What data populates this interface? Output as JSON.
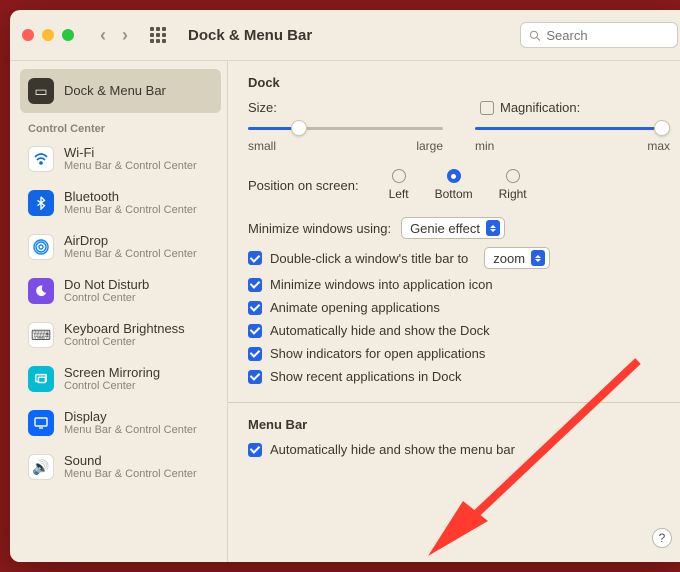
{
  "titlebar": {
    "title": "Dock & Menu Bar",
    "search_placeholder": "Search"
  },
  "sidebar": {
    "heading": "Control Center",
    "items": [
      {
        "label": "Dock & Menu Bar",
        "sub": ""
      },
      {
        "label": "Wi-Fi",
        "sub": "Menu Bar & Control Center"
      },
      {
        "label": "Bluetooth",
        "sub": "Menu Bar & Control Center"
      },
      {
        "label": "AirDrop",
        "sub": "Menu Bar & Control Center"
      },
      {
        "label": "Do Not Disturb",
        "sub": "Control Center"
      },
      {
        "label": "Keyboard Brightness",
        "sub": "Control Center"
      },
      {
        "label": "Screen Mirroring",
        "sub": "Control Center"
      },
      {
        "label": "Display",
        "sub": "Menu Bar & Control Center"
      },
      {
        "label": "Sound",
        "sub": "Menu Bar & Control Center"
      }
    ]
  },
  "dock": {
    "section_title": "Dock",
    "size_label": "Size:",
    "magnification_label": "Magnification:",
    "small": "small",
    "large": "large",
    "min": "min",
    "max": "max",
    "position_label": "Position on screen:",
    "positions": {
      "left": "Left",
      "bottom": "Bottom",
      "right": "Right"
    },
    "minimize_label": "Minimize windows using:",
    "minimize_value": "Genie effect",
    "doubleclick_label": "Double-click a window's title bar to",
    "doubleclick_value": "zoom",
    "checks": {
      "min_into_app": "Minimize windows into application icon",
      "animate": "Animate opening applications",
      "autohide_dock": "Automatically hide and show the Dock",
      "indicators": "Show indicators for open applications",
      "recent": "Show recent applications in Dock"
    }
  },
  "menubar": {
    "section_title": "Menu Bar",
    "autohide": "Automatically hide and show the menu bar"
  },
  "help": "?"
}
